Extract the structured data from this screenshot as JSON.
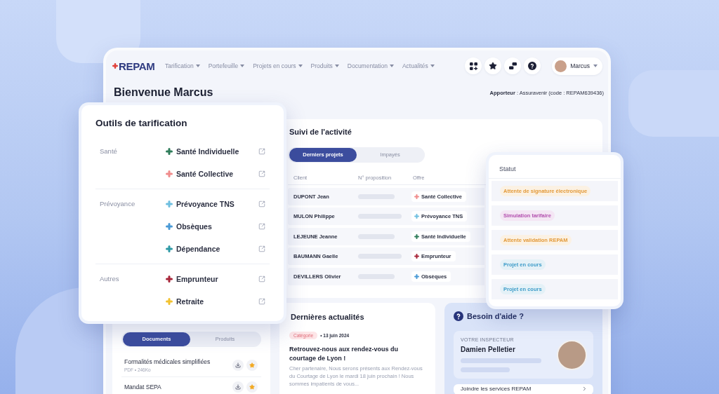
{
  "header": {
    "logo": "REPAM",
    "nav": [
      {
        "label": "Tarification"
      },
      {
        "label": "Portefeuille"
      },
      {
        "label": "Projets en cours"
      },
      {
        "label": "Produits"
      },
      {
        "label": "Documentation"
      },
      {
        "label": "Actualités"
      }
    ],
    "user": {
      "name": "Marcus"
    }
  },
  "welcome": {
    "title": "Bienvenue Marcus",
    "apporteur": "**Apporteur** : Assuravenir (code : REPAM639436)"
  },
  "tarification_card": {
    "title": "Outils de tarification",
    "groups": [
      {
        "label": "Santé",
        "items": [
          {
            "label": "Santé Individuelle",
            "color": "#2f7d5b"
          },
          {
            "label": "Santé Collective",
            "color": "#f08c8c"
          }
        ]
      },
      {
        "label": "Prévoyance",
        "items": [
          {
            "label": "Prévoyance TNS",
            "color": "#6fbfe0"
          },
          {
            "label": "Obsèques",
            "color": "#4a9ad6"
          },
          {
            "label": "Dépendance",
            "color": "#2e9aa6"
          }
        ]
      },
      {
        "label": "Autres",
        "items": [
          {
            "label": "Emprunteur",
            "color": "#a8263a"
          },
          {
            "label": "Retraite",
            "color": "#f2c230"
          }
        ]
      }
    ]
  },
  "activity": {
    "title": "Suivi de l'activité",
    "tabs": [
      {
        "label": "Derniers projets",
        "selected": true
      },
      {
        "label": "Impayés",
        "selected": false
      }
    ],
    "columns": [
      "Client",
      "N° proposition",
      "Offre"
    ],
    "rows": [
      {
        "client": "DUPONT Jean",
        "offer": "Santé Collective",
        "color": "#f08c8c"
      },
      {
        "client": "MULON Philippe",
        "offer": "Prévoyance TNS",
        "color": "#6fbfe0"
      },
      {
        "client": "LEJEUNE Jeanne",
        "offer": "Santé Individuelle",
        "color": "#2f7d5b"
      },
      {
        "client": "BAUMANN Gaelle",
        "offer": "Emprunteur",
        "color": "#a8263a"
      },
      {
        "client": "DEVILLERS Olivier",
        "offer": "Obsèques",
        "color": "#4a9ad6"
      }
    ]
  },
  "status_card": {
    "title": "Statut",
    "statuses": [
      {
        "label": "Attente de signature électronique",
        "color": "#e39a3a"
      },
      {
        "label": "Simulation tarifaire",
        "color": "#b24fae"
      },
      {
        "label": "Attente validation REPAM",
        "color": "#e39a3a"
      },
      {
        "label": "Projet en cours",
        "color": "#3e9cc9"
      },
      {
        "label": "Projet en cours",
        "color": "#3e9cc9"
      }
    ]
  },
  "documents": {
    "tabs": [
      {
        "label": "Documents",
        "selected": true
      },
      {
        "label": "Produits",
        "selected": false
      }
    ],
    "items": [
      {
        "title": "Formalités médicales simplifiées",
        "meta": "PDF • 246Ko"
      },
      {
        "title": "Mandat SEPA"
      }
    ]
  },
  "news": {
    "title": "Dernières actualités",
    "category": "Catégorie",
    "date": "• 13 juin 2024",
    "headline": "Retrouvez-nous aux rendez-vous du courtage de Lyon !",
    "excerpt": "Cher partenaire, Nous serons présents aux Rendez-vous du Courtage de Lyon le mardi 18 juin prochain ! Nous sommes impatients de vous..."
  },
  "help": {
    "title": "Besoin d'aide ?",
    "inspector_label": "VOTRE INSPECTEUR",
    "inspector_name": "Damien Pelletier",
    "link": "Joindre les services REPAM"
  }
}
